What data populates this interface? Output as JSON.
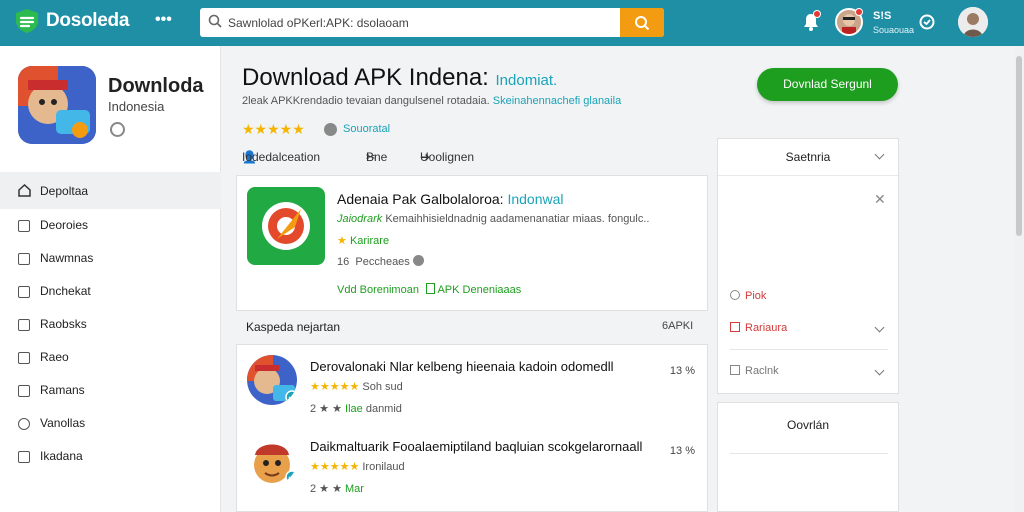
{
  "colors": {
    "topbar": "#1f8fa6",
    "accent": "#1ba3b8",
    "download_green": "#1e9e1e",
    "search_button": "#f39c12",
    "star": "#f5b400"
  },
  "header": {
    "brand": "Dosoleda",
    "menu_icon": "dots-icon",
    "search_value": "Sawnlolad oPKerl:APK: dsolaoam",
    "user_label": "S!S",
    "user_sub": "Souaouaa"
  },
  "app": {
    "title": "Downloda",
    "subtitle": "Indonesia"
  },
  "sidebar": {
    "items": [
      {
        "label": "Depoltaa",
        "icon": "home-icon"
      },
      {
        "label": "Deoroies",
        "icon": "folder-icon"
      },
      {
        "label": "Nawmnas",
        "icon": "edit-icon"
      },
      {
        "label": "Dnchekat",
        "icon": "document-icon"
      },
      {
        "label": "Raobsks",
        "icon": "book-icon"
      },
      {
        "label": "Raeo",
        "icon": "checkbox-icon"
      },
      {
        "label": "Ramans",
        "icon": "user-icon"
      },
      {
        "label": "Vanollas",
        "icon": "compass-icon"
      },
      {
        "label": "Ikadana",
        "icon": "square-icon"
      }
    ]
  },
  "main": {
    "title": "Download APK Indena:",
    "title_tag": "Indomiat.",
    "subtitle": "2leak APKKrendadio tevaian dangulsenel rotadaia.",
    "subtitle_tag": "Skeinahennachefi glanaila",
    "rating_stars": "★★★★★",
    "rating_label": "Souoratal",
    "download_label": "Dovnlad Sergunl",
    "meta": [
      {
        "label": "Iodedalceation",
        "icon": "person-icon"
      },
      {
        "label": "Bne",
        "icon": "tools-icon"
      },
      {
        "label": "Uoolignen",
        "icon": "arrow-icon"
      }
    ]
  },
  "featured": {
    "title": "Adenaia Pak Galbolaloroa:",
    "title_tag": "Indonwal",
    "desc_tag": "Jaiodrark",
    "desc": "Kemaihhisieldnadnig aadamenanatiar miaas. fongulc..",
    "stars_label": "Karirare",
    "count": "16",
    "count_label": "Peccheaes",
    "link": "Vdd Borenimoan",
    "link2": "APK Deneniaaas"
  },
  "list": {
    "heading": "Kaspeda nejartan",
    "right_label": "6APKI",
    "items": [
      {
        "title": "Derovalonaki Nlar kelbeng hieenaia kadoin odomedll",
        "stars": "★★★★★",
        "rating_text": "Soh sud",
        "meta_prefix": "2 ★ ★",
        "meta_green": "Ilae",
        "meta_suffix": "danmid",
        "right": "13 %"
      },
      {
        "title": "Daikmaltuarik Fooalaemiptiland baqluian scokgelarornaall",
        "stars": "★★★★★",
        "rating_text": "Ironilaud",
        "meta_prefix": "2 ★ ★",
        "meta_green": "Mar",
        "meta_suffix": "",
        "right": "13 %"
      }
    ]
  },
  "right_panel": {
    "title": "Saetnria",
    "options": [
      {
        "label": "Piok",
        "color": "#d23b3b"
      },
      {
        "label": "Rariaura",
        "color": "#d23b3b"
      },
      {
        "label": "Raclnk",
        "color": "#777777"
      }
    ],
    "panel2_title": "Oovrlán"
  }
}
